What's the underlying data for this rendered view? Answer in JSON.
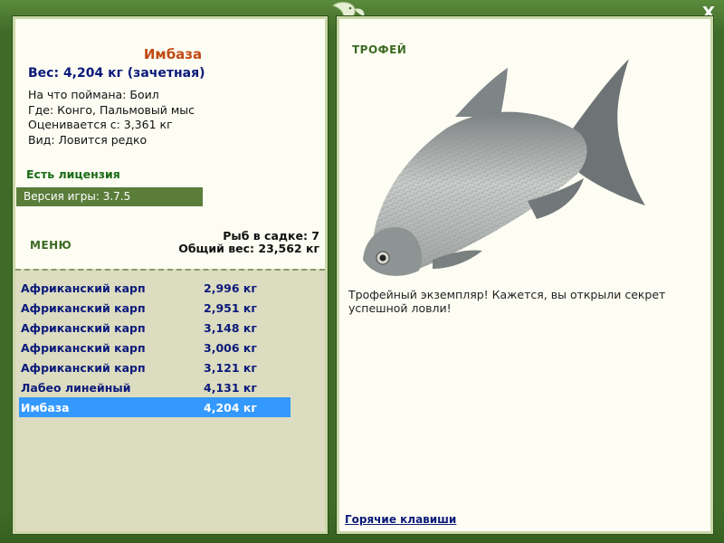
{
  "fish": {
    "name": "Имбаза",
    "weight": "Вес: 4,204 кг (зачетная)",
    "details": [
      "На что поймана: Боил",
      "Где: Конго, Пальмовый мыс",
      "Оценивается с: 3,361 кг",
      "Вид: Ловится редко"
    ]
  },
  "license": "Есть лицензия",
  "version": "Версия игры: 3.7.5",
  "menu_label": "МЕНЮ",
  "catch_summary": {
    "count": "Рыб в садке: 7",
    "total": "Общий вес: 23,562 кг"
  },
  "catch_list": [
    {
      "name": "Африканский карп",
      "weight": "2,996 кг"
    },
    {
      "name": "Африканский карп",
      "weight": "2,951 кг"
    },
    {
      "name": "Африканский карп",
      "weight": "3,148 кг"
    },
    {
      "name": "Африканский карп",
      "weight": "3,006 кг"
    },
    {
      "name": "Африканский карп",
      "weight": "3,121 кг"
    },
    {
      "name": "Лабео линейный",
      "weight": "4,131 кг"
    },
    {
      "name": "Имбаза",
      "weight": "4,204 кг"
    }
  ],
  "selected_index": 6,
  "trophy": {
    "label": "ТРОФЕЙ",
    "text": "Трофейный экземпляр! Кажется, вы открыли секрет успешной ловли!"
  },
  "hotkeys_label": "Горячие клавиши",
  "close_label": "X",
  "colors": {
    "frame": "#3f6b29",
    "panel": "#fdfdf3",
    "selection": "#3399ff",
    "fish_name": "#c04a12",
    "list_text": "#0b1a7a"
  },
  "icons": {
    "logo": "fish-logo-icon",
    "close": "close-icon",
    "trophy_image": "trophy-fish-image"
  }
}
